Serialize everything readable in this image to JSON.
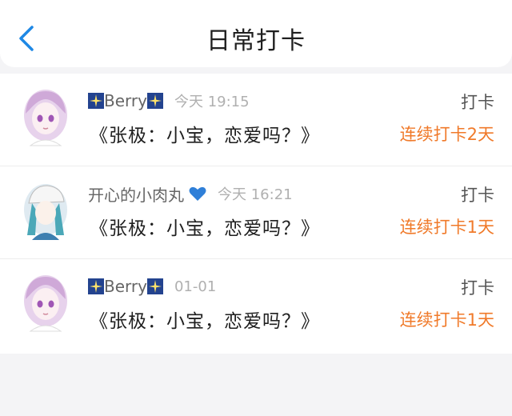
{
  "header": {
    "title": "日常打卡"
  },
  "entries": [
    {
      "name": "Berry",
      "time": "今天 19:15",
      "content": "《张极：小宝，恋爱吗？》",
      "action": "打卡",
      "streak": "连续打卡2天"
    },
    {
      "name": "开心的小肉丸",
      "time": "今天 16:21",
      "content": "《张极：小宝，恋爱吗？》",
      "action": "打卡",
      "streak": "连续打卡1天"
    },
    {
      "name": "Berry",
      "time": "01-01",
      "content": "《张极：小宝，恋爱吗？》",
      "action": "打卡",
      "streak": "连续打卡1天"
    }
  ],
  "colors": {
    "back": "#1e88e5",
    "streak": "#f07a2a",
    "heart": "#2f7fd8"
  },
  "icons": [
    "back-chevron-icon",
    "sparkle-badge-icon",
    "blue-heart-icon"
  ]
}
